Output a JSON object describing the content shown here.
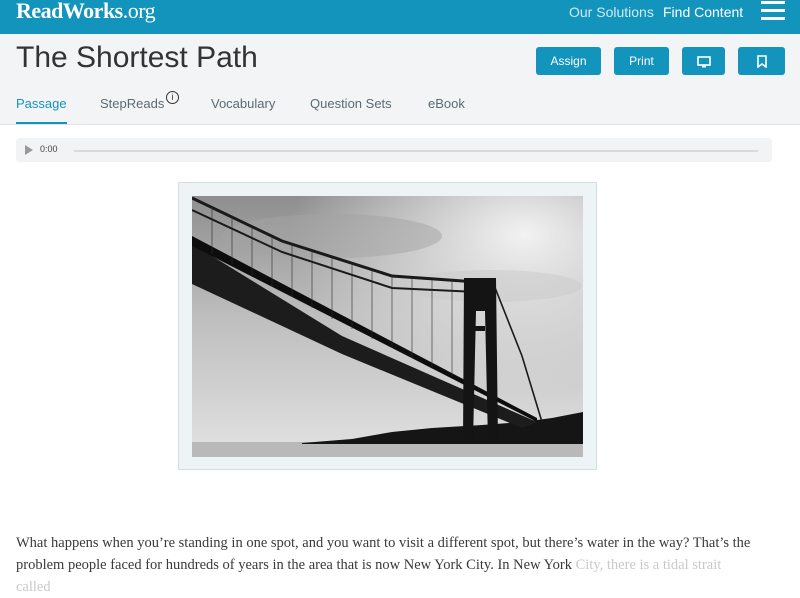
{
  "header": {
    "logo_main": "ReadWorks",
    "logo_suffix": ".org",
    "nav": {
      "solutions": "Our Solutions",
      "find": "Find Content"
    },
    "menu_icon": "hamburger-menu-icon"
  },
  "article": {
    "title": "The Shortest Path",
    "buttons": {
      "assign": "Assign",
      "print": "Print",
      "present_icon": "monitor-icon",
      "bookmark_icon": "bookmark-icon"
    },
    "tabs": [
      {
        "label": "Passage",
        "active": true
      },
      {
        "label": "StepReads",
        "active": false
      },
      {
        "label": "Vocabulary",
        "active": false
      },
      {
        "label": "Question Sets",
        "active": false
      },
      {
        "label": "eBook",
        "active": false
      }
    ],
    "info_glyph": "i"
  },
  "audio": {
    "time": "0:00",
    "progress": 0
  },
  "passage": {
    "text": "What happens when you’re standing in one spot, and you want to visit a different spot, but there’s water in the way? That’s the problem people faced for hundreds of years in the area that is now New York City. In New York",
    "faded": "City, there is a tidal strait called"
  },
  "colors": {
    "accent": "#1394bd",
    "header_bg": "#1394bd",
    "title_bg": "#f2f4f5"
  }
}
